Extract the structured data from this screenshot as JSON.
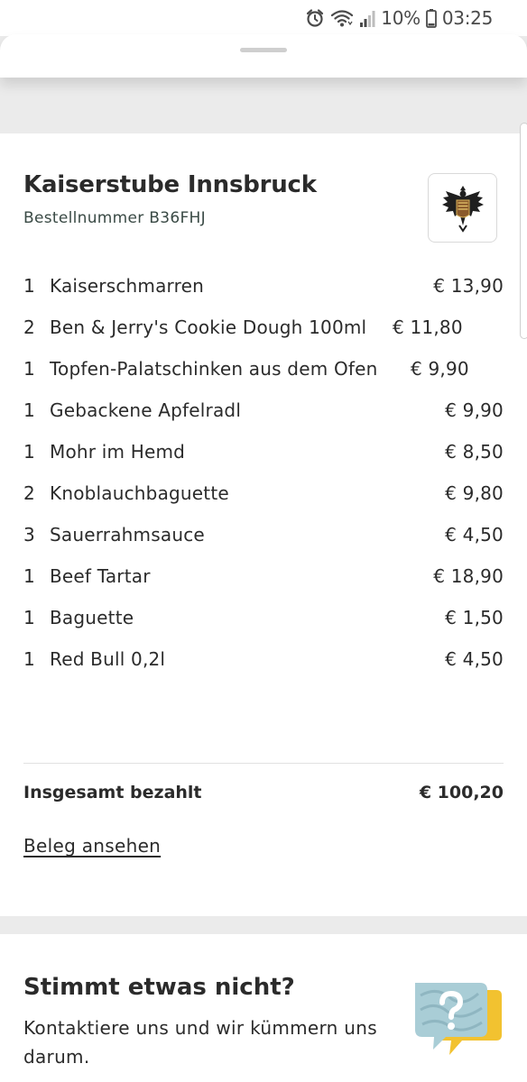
{
  "status_bar": {
    "battery": "10%",
    "time": "03:25",
    "icons": [
      "alarm-icon",
      "wifi-icon",
      "signal-icon",
      "battery-icon"
    ]
  },
  "order": {
    "restaurant_name": "Kaiserstube Innsbruck",
    "order_number": "Bestellnummer B36FHJ",
    "logo_alt": "KAISER STUBE",
    "items": [
      {
        "qty": "1",
        "name": "Kaiserschmarren",
        "price": "€ 13,90"
      },
      {
        "qty": "2",
        "name": "Ben & Jerry's Cookie Dough 100ml",
        "price": "€ 11,80"
      },
      {
        "qty": "1",
        "name": "Topfen-Palatschinken aus dem Ofen",
        "price": "€ 9,90"
      },
      {
        "qty": "1",
        "name": "Gebackene Apfelradl",
        "price": "€ 9,90"
      },
      {
        "qty": "1",
        "name": "Mohr im Hemd",
        "price": "€ 8,50"
      },
      {
        "qty": "2",
        "name": "Knoblauchbaguette",
        "price": "€ 9,80"
      },
      {
        "qty": "3",
        "name": "Sauerrahmsauce",
        "price": "€ 4,50"
      },
      {
        "qty": "1",
        "name": "Beef Tartar",
        "price": "€ 18,90"
      },
      {
        "qty": "1",
        "name": "Baguette",
        "price": "€ 1,50"
      },
      {
        "qty": "1",
        "name": "Red Bull 0,2l",
        "price": "€ 4,50"
      }
    ],
    "total_label": "Insgesamt bezahlt",
    "total_value": "€ 100,20",
    "receipt_link": "Beleg ansehen"
  },
  "help": {
    "title": "Stimmt etwas nicht?",
    "text": "Kontaktiere uns und wir kümmern uns darum."
  },
  "colors": {
    "text": "#2b2b2b",
    "background": "#ebebeb",
    "card": "#ffffff",
    "accent_yellow": "#f2c230",
    "accent_blue": "#a9cdd6"
  }
}
